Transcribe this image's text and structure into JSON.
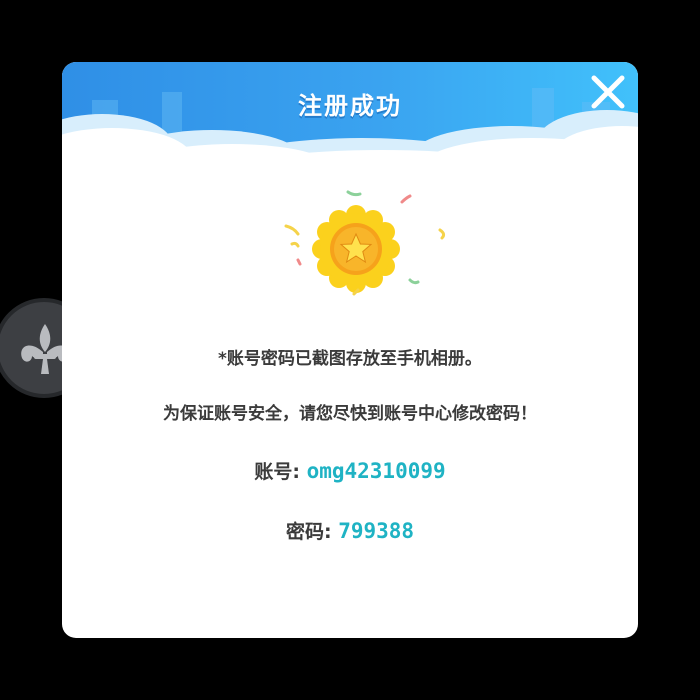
{
  "dialog": {
    "title": "注册成功",
    "message_line1": "*账号密码已截图存放至手机相册。",
    "message_line2": "为保证账号安全，请您尽快到账号中心修改密码！",
    "account_label": "账号:",
    "account_value": "omg42310099",
    "password_label": "密码:",
    "password_value": "799388"
  },
  "icons": {
    "close": "close-icon",
    "medal": "star-medal-icon",
    "floating": "fleur-de-lis-icon"
  },
  "colors": {
    "header": "#3aa3f0",
    "value_text": "#1fb3c4",
    "medal": "#f7c21b"
  }
}
